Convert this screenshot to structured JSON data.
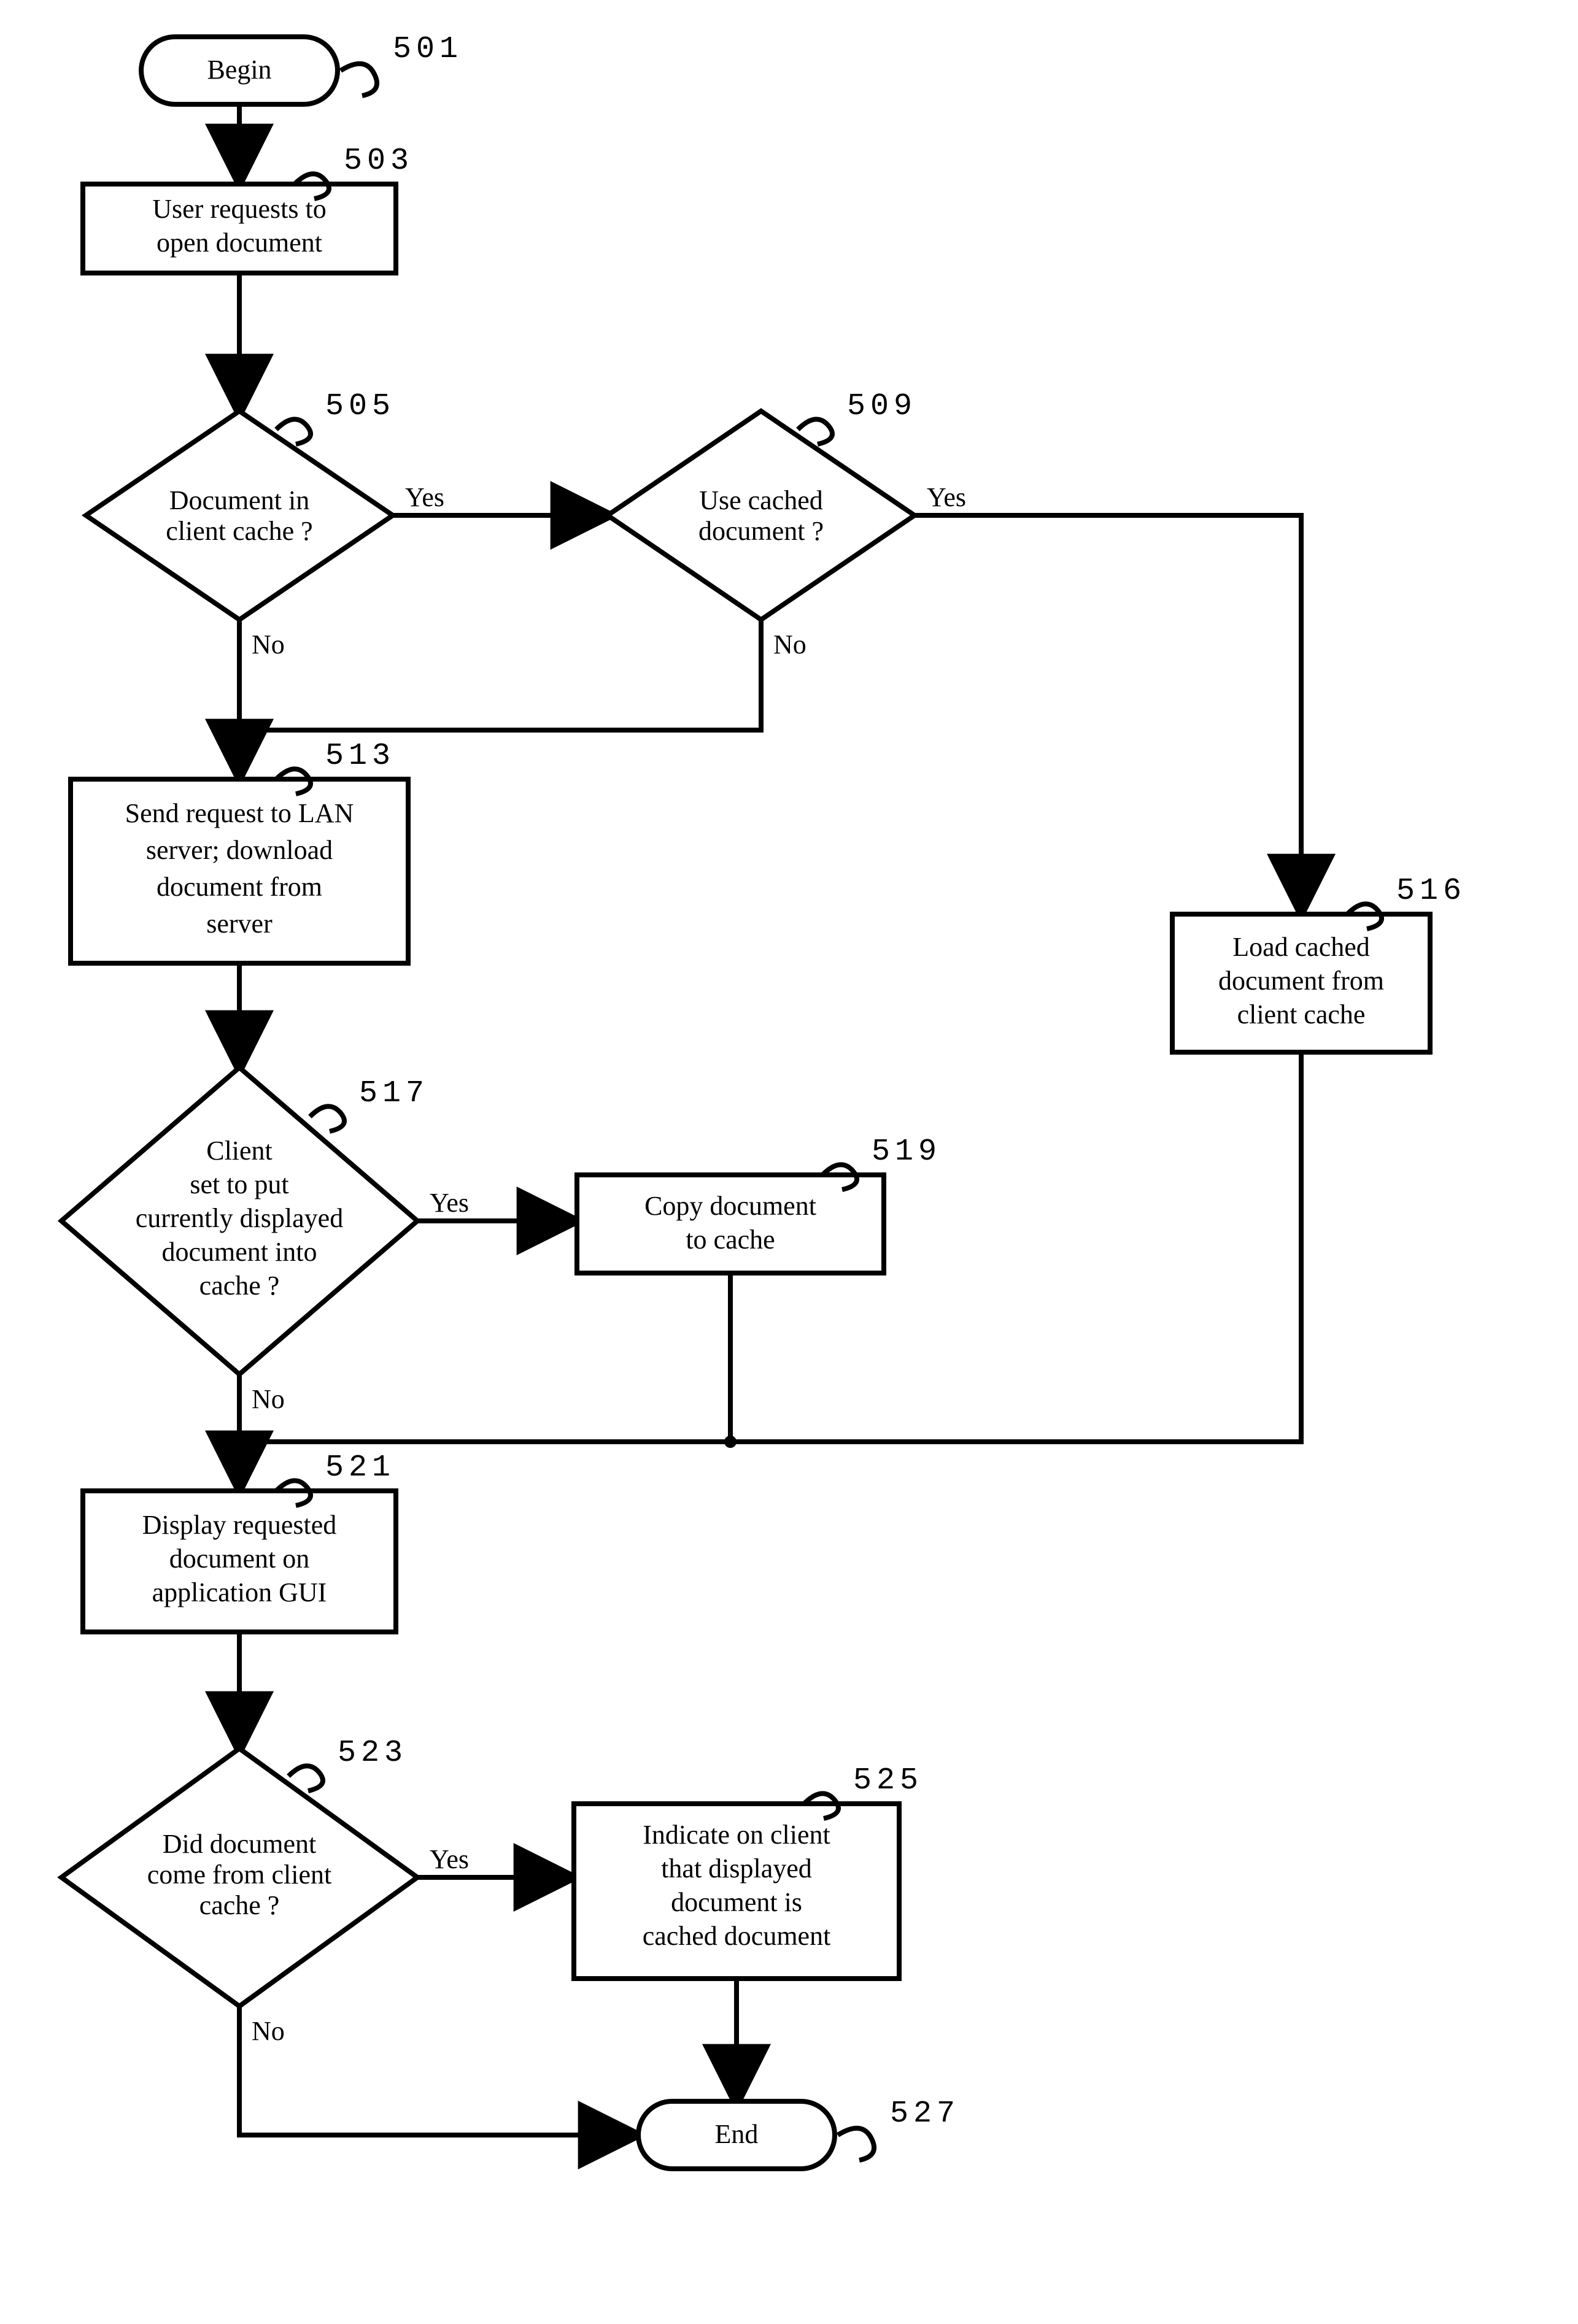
{
  "refs": {
    "r501": "501",
    "r503": "503",
    "r505": "505",
    "r509": "509",
    "r513": "513",
    "r516": "516",
    "r517": "517",
    "r519": "519",
    "r521": "521",
    "r523": "523",
    "r525": "525",
    "r527": "527"
  },
  "nodes": {
    "begin": "Begin",
    "end": "End",
    "n503a": "User requests to",
    "n503b": "open document",
    "n505a": "Document in",
    "n505b": "client cache ?",
    "n509a": "Use cached",
    "n509b": "document ?",
    "n513a": "Send request to LAN",
    "n513b": "server; download",
    "n513c": "document from",
    "n513d": "server",
    "n516a": "Load cached",
    "n516b": "document from",
    "n516c": "client cache",
    "n517a": "Client",
    "n517b": "set to put",
    "n517c": "currently displayed",
    "n517d": "document into",
    "n517e": "cache ?",
    "n519a": "Copy document",
    "n519b": "to cache",
    "n521a": "Display requested",
    "n521b": "document on",
    "n521c": "application GUI",
    "n523a": "Did document",
    "n523b": "come from client",
    "n523c": "cache ?",
    "n525a": "Indicate on client",
    "n525b": "that displayed",
    "n525c": "document is",
    "n525d": "cached document"
  },
  "labels": {
    "yes": "Yes",
    "no": "No"
  }
}
